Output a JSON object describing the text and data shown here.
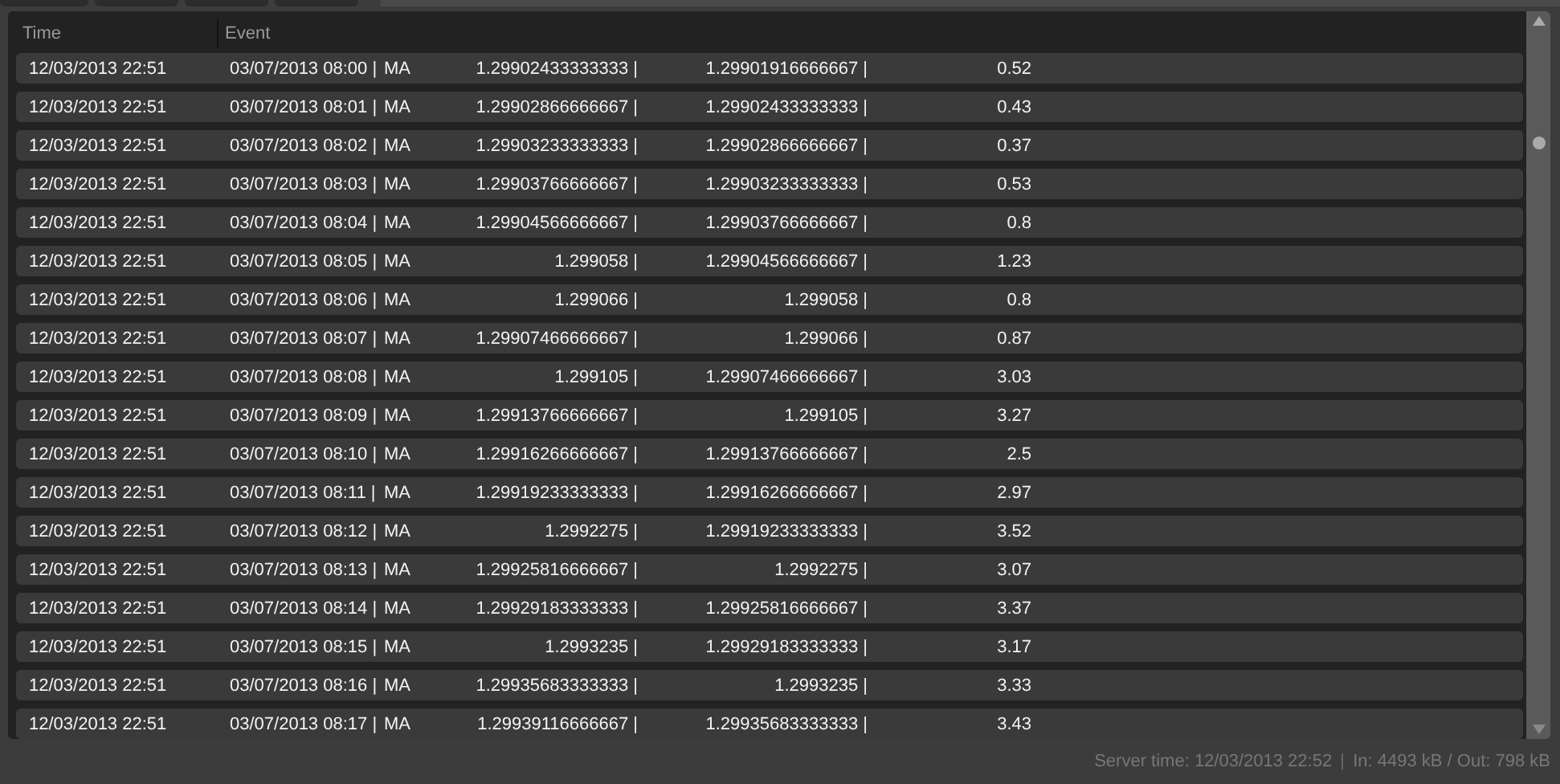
{
  "table": {
    "columns": [
      "Time",
      "Event"
    ],
    "rows": [
      {
        "time": "12/03/2013 22:51",
        "date": "03/07/2013 08:00 |",
        "label": "MA",
        "v1": "1.29902433333333 |",
        "v2": "1.29901916666667 |",
        "v3": "0.52"
      },
      {
        "time": "12/03/2013 22:51",
        "date": "03/07/2013 08:01 |",
        "label": "MA",
        "v1": "1.29902866666667 |",
        "v2": "1.29902433333333 |",
        "v3": "0.43"
      },
      {
        "time": "12/03/2013 22:51",
        "date": "03/07/2013 08:02 |",
        "label": "MA",
        "v1": "1.29903233333333 |",
        "v2": "1.29902866666667 |",
        "v3": "0.37"
      },
      {
        "time": "12/03/2013 22:51",
        "date": "03/07/2013 08:03 |",
        "label": "MA",
        "v1": "1.29903766666667 |",
        "v2": "1.29903233333333 |",
        "v3": "0.53"
      },
      {
        "time": "12/03/2013 22:51",
        "date": "03/07/2013 08:04 |",
        "label": "MA",
        "v1": "1.29904566666667 |",
        "v2": "1.29903766666667 |",
        "v3": "0.8"
      },
      {
        "time": "12/03/2013 22:51",
        "date": "03/07/2013 08:05 |",
        "label": "MA",
        "v1": "1.299058 |",
        "v2": "1.29904566666667 |",
        "v3": "1.23"
      },
      {
        "time": "12/03/2013 22:51",
        "date": "03/07/2013 08:06 |",
        "label": "MA",
        "v1": "1.299066 |",
        "v2": "1.299058 |",
        "v3": "0.8"
      },
      {
        "time": "12/03/2013 22:51",
        "date": "03/07/2013 08:07 |",
        "label": "MA",
        "v1": "1.29907466666667 |",
        "v2": "1.299066 |",
        "v3": "0.87"
      },
      {
        "time": "12/03/2013 22:51",
        "date": "03/07/2013 08:08 |",
        "label": "MA",
        "v1": "1.299105 |",
        "v2": "1.29907466666667 |",
        "v3": "3.03"
      },
      {
        "time": "12/03/2013 22:51",
        "date": "03/07/2013 08:09 |",
        "label": "MA",
        "v1": "1.29913766666667 |",
        "v2": "1.299105 |",
        "v3": "3.27"
      },
      {
        "time": "12/03/2013 22:51",
        "date": "03/07/2013 08:10 |",
        "label": "MA",
        "v1": "1.29916266666667 |",
        "v2": "1.29913766666667 |",
        "v3": "2.5"
      },
      {
        "time": "12/03/2013 22:51",
        "date": "03/07/2013 08:11 |",
        "label": "MA",
        "v1": "1.29919233333333 |",
        "v2": "1.29916266666667 |",
        "v3": "2.97"
      },
      {
        "time": "12/03/2013 22:51",
        "date": "03/07/2013 08:12 |",
        "label": "MA",
        "v1": "1.2992275 |",
        "v2": "1.29919233333333 |",
        "v3": "3.52"
      },
      {
        "time": "12/03/2013 22:51",
        "date": "03/07/2013 08:13 |",
        "label": "MA",
        "v1": "1.29925816666667 |",
        "v2": "1.2992275 |",
        "v3": "3.07"
      },
      {
        "time": "12/03/2013 22:51",
        "date": "03/07/2013 08:14 |",
        "label": "MA",
        "v1": "1.29929183333333 |",
        "v2": "1.29925816666667 |",
        "v3": "3.37"
      },
      {
        "time": "12/03/2013 22:51",
        "date": "03/07/2013 08:15 |",
        "label": "MA",
        "v1": "1.2993235 |",
        "v2": "1.29929183333333 |",
        "v3": "3.17"
      },
      {
        "time": "12/03/2013 22:51",
        "date": "03/07/2013 08:16 |",
        "label": "MA",
        "v1": "1.29935683333333 |",
        "v2": "1.2993235 |",
        "v3": "3.33"
      },
      {
        "time": "12/03/2013 22:51",
        "date": "03/07/2013 08:17 |",
        "label": "MA",
        "v1": "1.29939116666667 |",
        "v2": "1.29935683333333 |",
        "v3": "3.43"
      }
    ]
  },
  "status_bar": {
    "server_time": "Server time: 12/03/2013 22:52",
    "traffic": "In: 4493 kB / Out: 798 kB"
  }
}
